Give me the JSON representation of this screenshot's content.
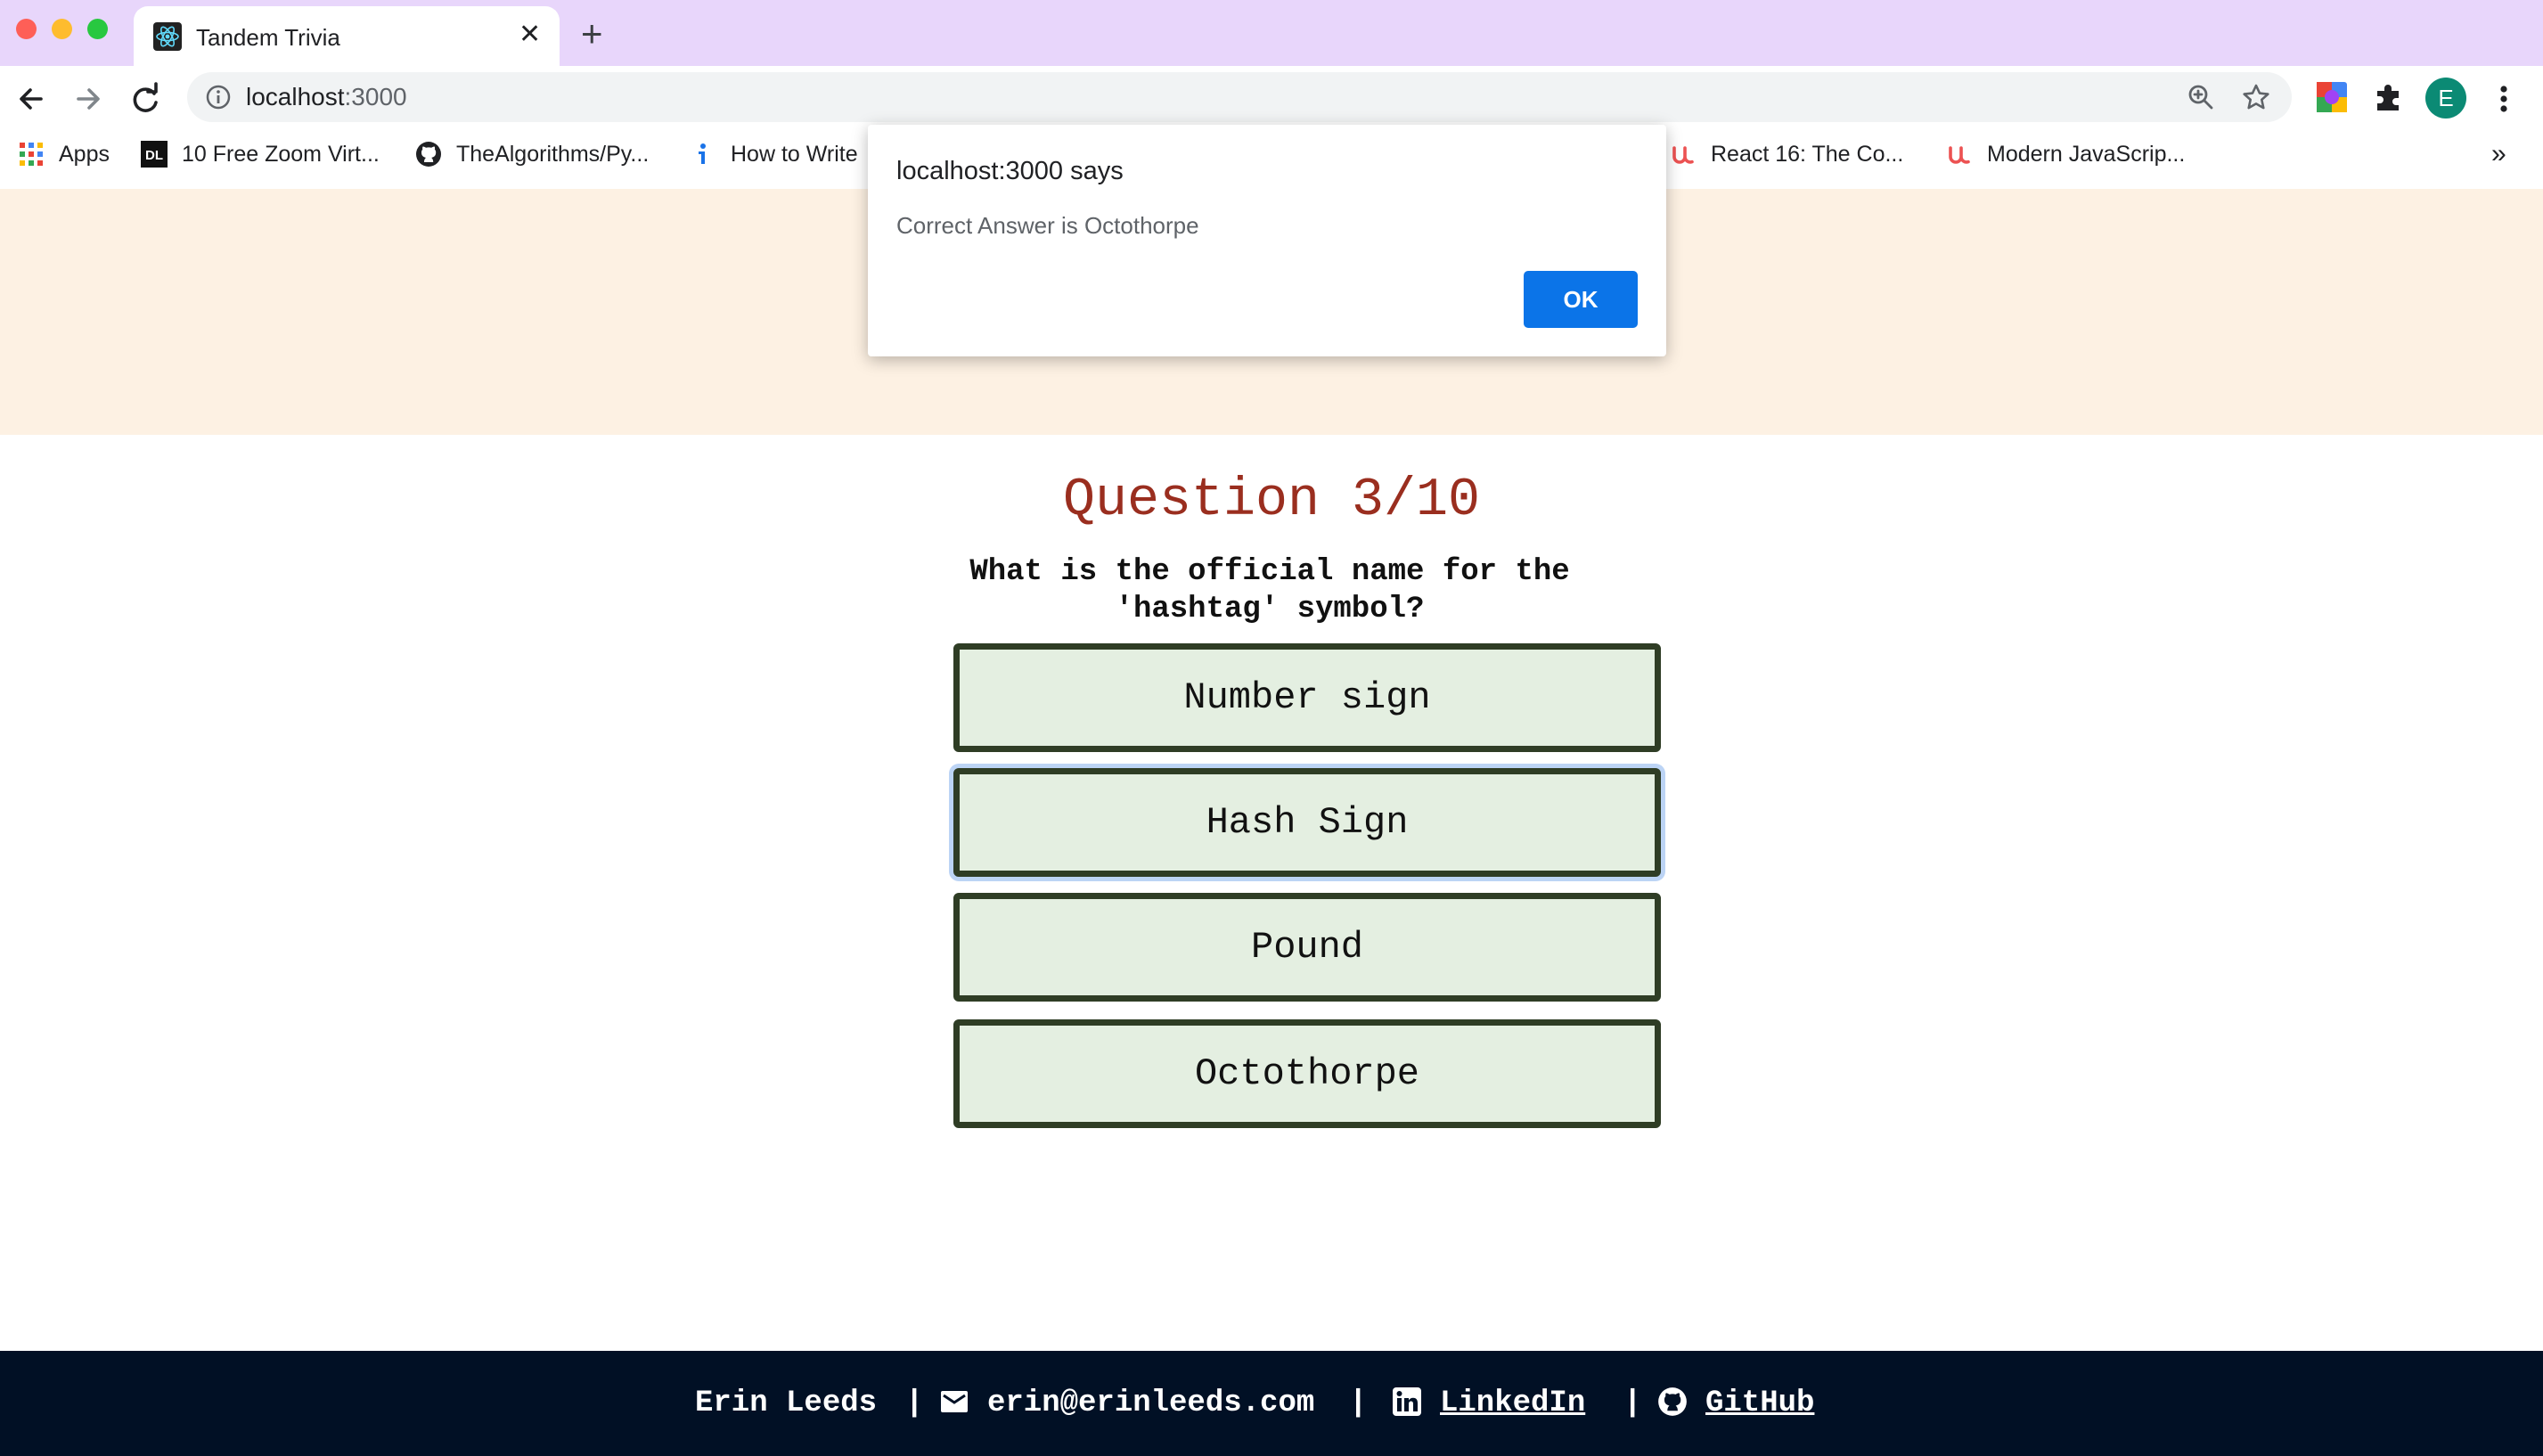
{
  "browser": {
    "tab_title": "Tandem Trivia",
    "url_host": "localhost",
    "url_port": ":3000",
    "avatar_letter": "E",
    "bookmarks": [
      {
        "label": "Apps",
        "icon": "apps-grid-icon"
      },
      {
        "label": "10 Free Zoom Virt...",
        "icon": "dl-logo-icon"
      },
      {
        "label": "TheAlgorithms/Py...",
        "icon": "github-icon"
      },
      {
        "label": "How to Write",
        "icon": "info-i-icon"
      },
      {
        "label": "React 16: The Co...",
        "icon": "udemy-icon"
      },
      {
        "label": "Modern JavaScrip...",
        "icon": "udemy-icon"
      }
    ],
    "overflow_label": "»"
  },
  "alert": {
    "title": "localhost:3000 says",
    "message": "Correct Answer is Octothorpe",
    "ok_label": "OK"
  },
  "quiz": {
    "question_title": "Question 3/10",
    "question_text": "What is the official name for the 'hashtag' symbol?",
    "answers": [
      "Number sign",
      "Hash Sign",
      "Pound",
      "Octothorpe"
    ],
    "focused_answer": "Hash Sign"
  },
  "footer": {
    "name": "Erin Leeds",
    "separator": "|",
    "email": "erin@erinleeds.com",
    "linkedin_label": "LinkedIn",
    "github_label": "GitHub"
  },
  "colors": {
    "tabbar": "#e8d6fb",
    "banner": "#fdf1e3",
    "question_title": "#9a2e1f",
    "answer_fill": "#e4efe1",
    "answer_border": "#2f3d25",
    "footer": "#011025",
    "ok_button": "#0b74e8"
  }
}
